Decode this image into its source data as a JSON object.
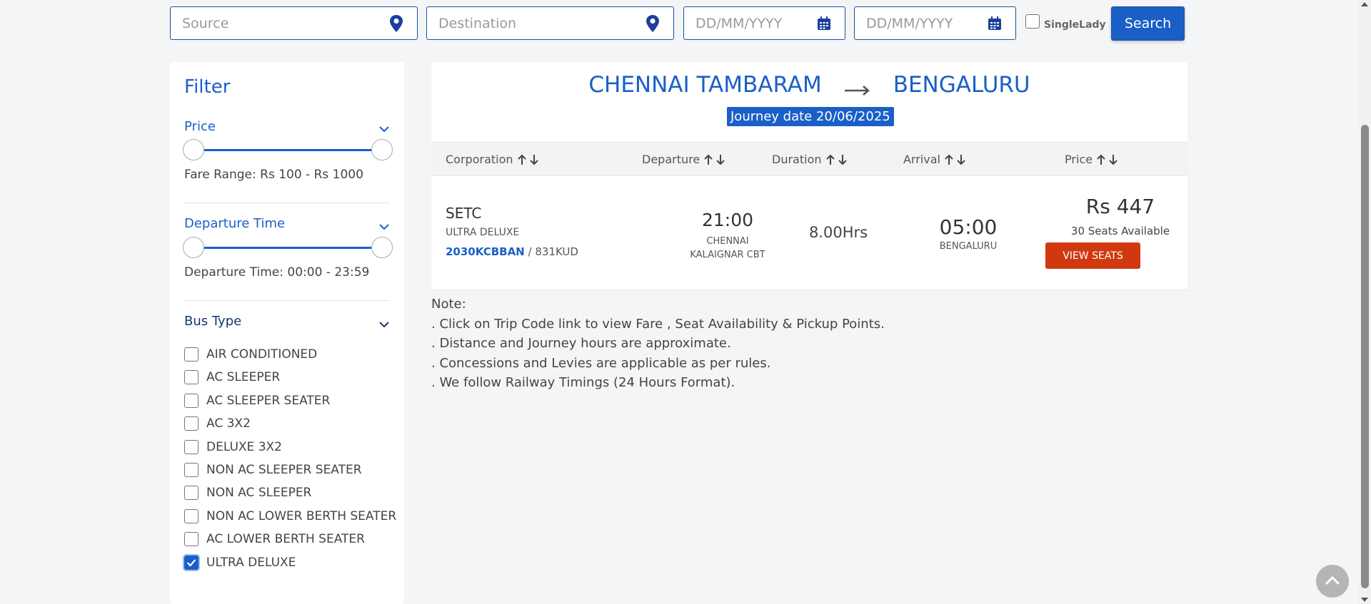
{
  "search": {
    "source_placeholder": "Source",
    "destination_placeholder": "Destination",
    "date1_placeholder": "DD/MM/YYYY",
    "date2_placeholder": "DD/MM/YYYY",
    "single_lady_label": "SingleLady",
    "single_lady_checked": false,
    "search_label": "Search"
  },
  "filter": {
    "title": "Filter",
    "price": {
      "title": "Price",
      "text": "Fare Range: Rs 100 - Rs 1000"
    },
    "departure": {
      "title": "Departure Time",
      "text": "Departure Time: 00:00 - 23:59"
    },
    "bus_type": {
      "title": "Bus Type",
      "items": [
        {
          "label": "AIR CONDITIONED",
          "checked": false
        },
        {
          "label": "AC SLEEPER",
          "checked": false
        },
        {
          "label": "AC SLEEPER SEATER",
          "checked": false
        },
        {
          "label": "AC 3X2",
          "checked": false
        },
        {
          "label": "DELUXE 3X2",
          "checked": false
        },
        {
          "label": "NON AC SLEEPER SEATER",
          "checked": false
        },
        {
          "label": "NON AC SLEEPER",
          "checked": false
        },
        {
          "label": "NON AC LOWER BERTH SEATER",
          "checked": false
        },
        {
          "label": "AC LOWER BERTH SEATER",
          "checked": false
        },
        {
          "label": "ULTRA DELUXE",
          "checked": true
        }
      ]
    }
  },
  "results": {
    "from": "CHENNAI TAMBARAM",
    "to": "BENGALURU",
    "journey_date": "Journey date 20/06/2025",
    "columns": [
      "Corporation",
      "Departure",
      "Duration",
      "Arrival",
      "Price"
    ],
    "trip": {
      "corporation": "SETC",
      "type": "ULTRA DELUXE",
      "trip_code": "2030KCBBAN",
      "route_code": "/ 831KUD",
      "departure_time": "21:00",
      "departure_place_line1": "CHENNAI",
      "departure_place_line2": "KALAIGNAR CBT",
      "duration": "8.00Hrs",
      "arrival_time": "05:00",
      "arrival_place": "BENGALURU",
      "price": "Rs 447",
      "seats": "30 Seats Available",
      "view_label": "VIEW SEATS"
    }
  },
  "notes": [
    "Note:",
    ". Click on Trip Code link to view Fare , Seat Availability & Pickup Points.",
    ". Distance and Journey hours are approximate.",
    ". Concessions and Levies are applicable as per rules.",
    ". We follow Railway Timings (24 Hours Format)."
  ],
  "colors": {
    "primary": "#1a5fc8",
    "view_seats": "#d0390f"
  }
}
